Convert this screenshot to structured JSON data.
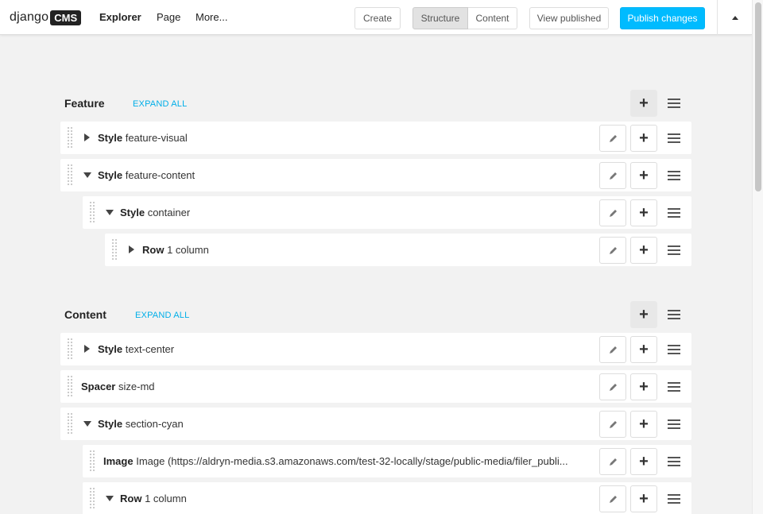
{
  "toolbar": {
    "logo_text": "django",
    "logo_badge": "CMS",
    "menu": [
      {
        "label": "Explorer"
      },
      {
        "label": "Page"
      },
      {
        "label": "More..."
      }
    ],
    "create_label": "Create",
    "structure_label": "Structure",
    "content_label": "Content",
    "view_published_label": "View published",
    "publish_label": "Publish changes",
    "active_mode": "Structure",
    "accent_color": "#00bbff"
  },
  "placeholders": [
    {
      "title": "Feature",
      "expand_label": "EXPAND ALL",
      "plugins": [
        {
          "type": "Style",
          "name": "feature-visual",
          "expanded": false
        },
        {
          "type": "Style",
          "name": "feature-content",
          "expanded": true
        },
        {
          "type": "Style",
          "name": "container",
          "expanded": true
        },
        {
          "type": "Row",
          "name": "1 column",
          "expanded": false
        }
      ]
    },
    {
      "title": "Content",
      "expand_label": "EXPAND ALL",
      "plugins": [
        {
          "type": "Style",
          "name": "text-center",
          "expanded": false
        },
        {
          "type": "Spacer",
          "name": "size-md"
        },
        {
          "type": "Style",
          "name": "section-cyan",
          "expanded": true
        },
        {
          "type": "Image",
          "name": "Image (https://aldryn-media.s3.amazonaws.com/test-32-locally/stage/public-media/filer_publi..."
        },
        {
          "type": "Row",
          "name": "1 column",
          "expanded": true
        }
      ]
    }
  ],
  "icons": {
    "edit": "pencil-icon",
    "add": "plus-icon",
    "menu": "hamburger-menu-icon",
    "collapse": "caret-up-icon",
    "drag": "drag-handle-icon"
  }
}
